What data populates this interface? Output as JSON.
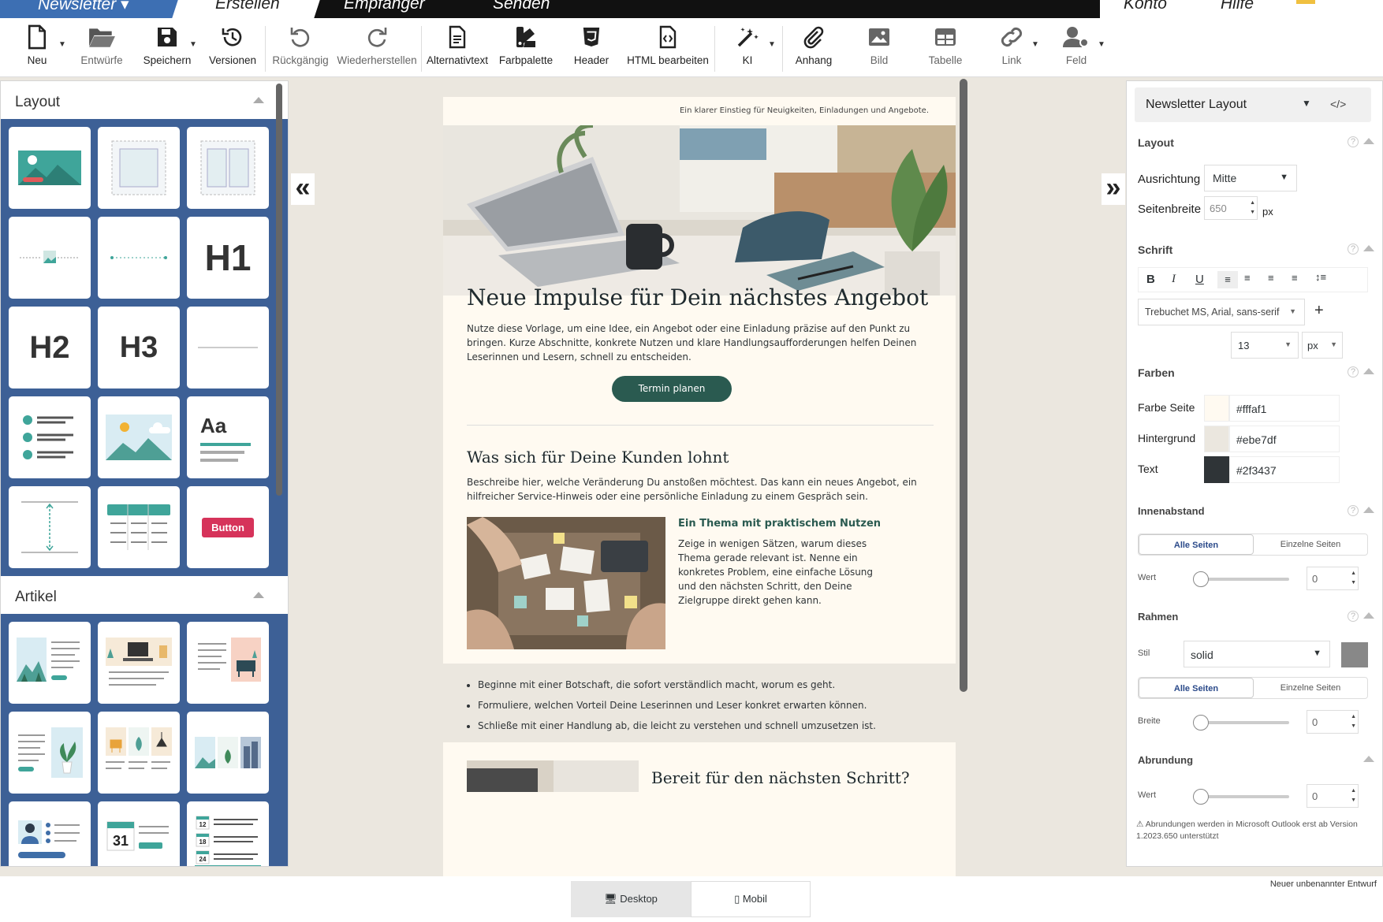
{
  "topnav": {
    "items": [
      "Newsletter ▾",
      "Erstellen",
      "Empfänger",
      "Senden",
      "Konto",
      "Hilfe"
    ]
  },
  "toolbar": {
    "new": "Neu",
    "drafts": "Entwürfe",
    "save": "Speichern",
    "versions": "Versionen",
    "undo": "Rückgängig",
    "redo": "Wiederherstellen",
    "alttext": "Alternativtext",
    "palette": "Farbpalette",
    "header": "Header",
    "html": "HTML bearbeiten",
    "ai": "KI",
    "attach": "Anhang",
    "image": "Bild",
    "table": "Tabelle",
    "link": "Link",
    "field": "Feld"
  },
  "left": {
    "layout_title": "Layout",
    "article_title": "Artikel",
    "h1": "H1",
    "h2": "H2",
    "h3": "H3",
    "aa": "Aa",
    "button": "Button",
    "cal31": "31",
    "cal12": "12",
    "cal18": "18",
    "cal24": "24"
  },
  "email": {
    "preheader": "Ein klarer Einstieg für Neuigkeiten, Einladungen und Angebote.",
    "title": "Neue Impulse für Dein nächstes Angebot",
    "intro": "Nutze diese Vorlage, um eine Idee, ein Angebot oder eine Einladung präzise auf den Punkt zu bringen. Kurze Abschnitte, konkrete Nutzen und klare Handlungsaufforderungen helfen Deinen Leserinnen und Lesern, schnell zu entscheiden.",
    "cta": "Termin planen",
    "h2": "Was sich für Deine Kunden lohnt",
    "p2": "Beschreibe hier, welche Veränderung Du anstoßen möchtest. Das kann ein neues Angebot, ein hilfreicher Service-Hinweis oder eine persönliche Einladung zu einem Gespräch sein.",
    "art_title": "Ein Thema mit praktischem Nutzen",
    "art_text": "Zeige in wenigen Sätzen, warum dieses Thema gerade relevant ist. Nenne ein konkretes Problem, eine einfache Lösung und den nächsten Schritt, den Deine Zielgruppe direkt gehen kann.",
    "bullets": [
      "Beginne mit einer Botschaft, die sofort verständlich macht, worum es geht.",
      "Formuliere, welchen Vorteil Deine Leserinnen und Leser konkret erwarten können.",
      "Schließe mit einer Handlung ab, die leicht zu verstehen und schnell umzusetzen ist."
    ],
    "h3": "Bereit für den nächsten Schritt?"
  },
  "right": {
    "select": "Newsletter Layout",
    "code": "</>",
    "layout": "Layout",
    "align_label": "Ausrichtung",
    "align_value": "Mitte",
    "width_label": "Seitenbreite",
    "width_value": "650",
    "px": "px",
    "font": "Schrift",
    "font_family": "Trebuchet MS, Arial, sans-serif",
    "font_size": "13",
    "font_unit": "px",
    "colors": "Farben",
    "c_page_label": "Farbe Seite",
    "c_page": "#fffaf1",
    "c_bg_label": "Hintergrund",
    "c_bg": "#ebe7df",
    "c_text_label": "Text",
    "c_text": "#2f3437",
    "padding": "Innenabstand",
    "all_sides": "Alle Seiten",
    "single_sides": "Einzelne Seiten",
    "value_label": "Wert",
    "zero": "0",
    "border": "Rahmen",
    "style_label": "Stil",
    "style_value": "solid",
    "width2_label": "Breite",
    "radius": "Abrundung",
    "note": "⚠ Abrundungen werden in Microsoft Outlook erst ab Version 1.2023.650 unterstützt"
  },
  "footer": {
    "desktop": "Desktop",
    "mobile": "Mobil",
    "draft": "Neuer unbenannter Entwurf"
  }
}
